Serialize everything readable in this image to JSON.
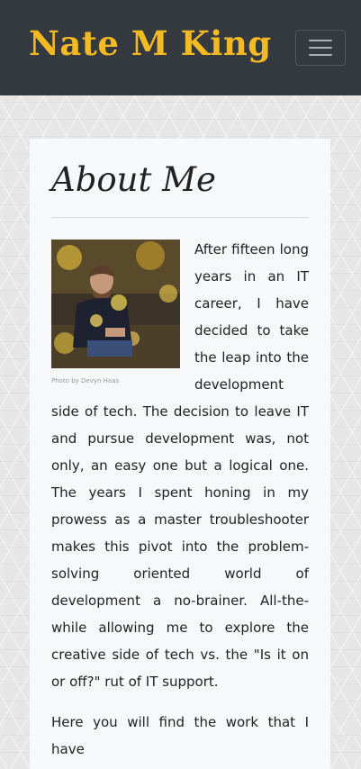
{
  "navbar": {
    "brand": "Nate M King",
    "toggle_icon": "hamburger-menu-icon"
  },
  "about": {
    "title": "About Me",
    "photo_caption": "Photo by Devyn Haas",
    "paragraphs": [
      "After fifteen long years in an IT career, I have decided to take the leap into the development side of tech. The decision to leave IT and pursue development was, not only, an easy one but a logical one. The years I spent honing in my prowess as a master troubleshooter makes this pivot into the problem-solving oriented world of development a no-brainer. All-the-while allowing me to explore the creative side of tech vs. the \"Is it on or off?\" rut of IT support.",
      "Here you will find the work that I have"
    ]
  },
  "colors": {
    "navbar_bg": "#343a40",
    "brand": "#f4ba24",
    "card_bg": "#f7f8fa"
  }
}
